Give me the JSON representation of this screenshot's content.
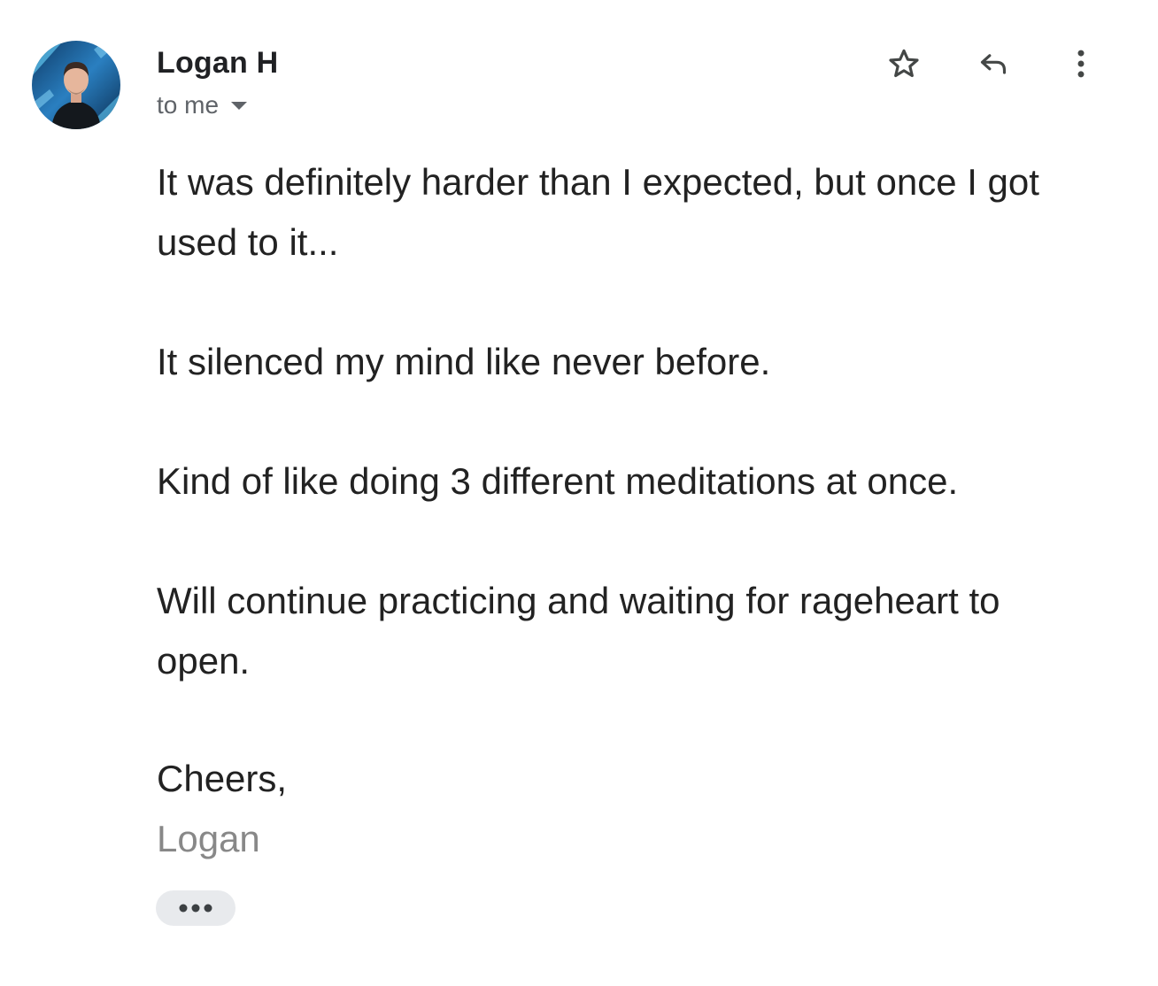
{
  "message": {
    "sender_name": "Logan H",
    "recipient_label": "to me",
    "paragraphs": [
      "It was definitely harder than I expected, but once I got used to it...",
      "It silenced my mind like never before.",
      "Kind of like doing 3 different meditations at once.",
      "Will continue practicing and waiting for rageheart to open."
    ],
    "closing": "Cheers,",
    "signature": "Logan"
  },
  "actions": {
    "star_icon": "star-outline-icon",
    "reply_icon": "reply-icon",
    "more_icon": "more-vert-icon",
    "trimmed_icon": "ellipsis-icon"
  },
  "colors": {
    "text": "#222222",
    "secondary_text": "#5f6368",
    "signature": "#888888",
    "trimmed_bg": "#e8eaed"
  }
}
